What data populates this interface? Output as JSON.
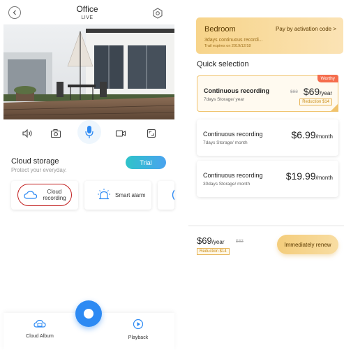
{
  "left": {
    "header": {
      "title": "Office",
      "subtitle": "LIVE"
    },
    "controls": [
      "speaker-icon",
      "camera-icon",
      "mic-icon",
      "record-icon",
      "fullscreen-icon"
    ],
    "cloud": {
      "title": "Cloud storage",
      "subtitle": "Protect your everyday.",
      "trial_label": "Trial"
    },
    "features": [
      {
        "label": "Cloud recording",
        "icon": "cloud-icon"
      },
      {
        "label": "Smart alarm",
        "icon": "alarm-icon"
      }
    ],
    "nav": {
      "album": "Cloud Album",
      "playback": "Playback"
    },
    "accent": "#2d8af3"
  },
  "right": {
    "status": {
      "name": "Bedroom",
      "action": "Pay by activation code >",
      "desc": "3days continuous recordi...",
      "expire": "Trail expires on 2019/12/18"
    },
    "quick_title": "Quick selection",
    "plans": [
      {
        "name": "Continuous recording",
        "desc": "7days Storage/ year",
        "old": "$83",
        "price": "$69",
        "unit": "/year",
        "reduction": "Reduction $14",
        "badge": "Worthy"
      },
      {
        "name": "Continuous recording",
        "desc": "7days Storage/ month",
        "price": "$6.99",
        "unit": "/month"
      },
      {
        "name": "Continuous recording",
        "desc": "30days Storage/ month",
        "price": "$19.99",
        "unit": "/month"
      }
    ],
    "footer": {
      "price": "$69",
      "unit": "/year",
      "old": "$83",
      "reduction": "Reduction $14",
      "button": "Immediately renew"
    },
    "gold": "#f4cd7c"
  }
}
